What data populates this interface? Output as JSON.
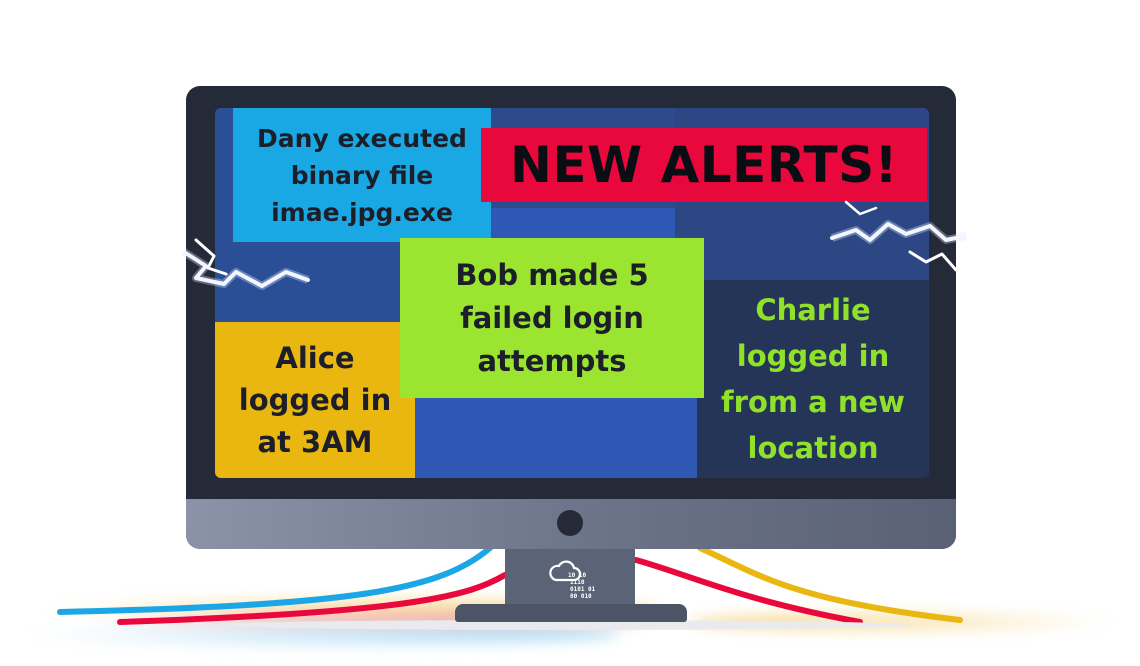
{
  "alerts": {
    "headline": "NEW ALERTS!",
    "dany": [
      "Dany executed",
      "binary file",
      "imae.jpg.exe"
    ],
    "bob": [
      "Bob made 5",
      "failed login",
      "attempts"
    ],
    "alice": [
      "Alice",
      "logged in",
      "at 3AM"
    ],
    "charlie": [
      "Charlie",
      "logged in",
      "from a new",
      "location"
    ]
  },
  "stand": {
    "binary": [
      "10  10",
      "1110",
      "0101  01",
      "00   010"
    ]
  },
  "colors": {
    "monitor_frame": "#252a38",
    "screen": "#2c4a8c",
    "headline_bg": "#e8083c",
    "dany_bg": "#1aa8e4",
    "bob_bg": "#9be530",
    "alice_bg": "#e9b70f",
    "charlie_bg": "#253558",
    "charlie_text": "#8fe12a",
    "cable_blue": "#1ba6e6",
    "cable_red": "#e8083c",
    "cable_yellow": "#e9b70f"
  },
  "icons": [
    "cloud-icon",
    "lightning-spark-icon"
  ]
}
